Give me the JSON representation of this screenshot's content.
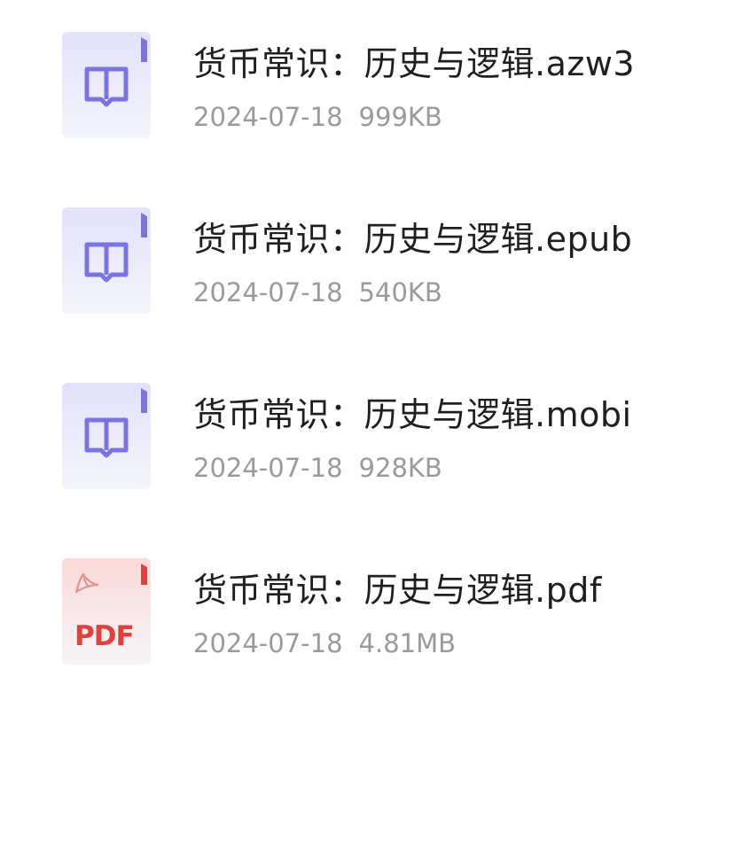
{
  "files": [
    {
      "name": "货币常识：历史与逻辑.azw3",
      "date": "2024-07-18",
      "size": "999KB",
      "icon": "ebook-icon",
      "icon_color": "#7b74e0"
    },
    {
      "name": "货币常识：历史与逻辑.epub",
      "date": "2024-07-18",
      "size": "540KB",
      "icon": "ebook-icon",
      "icon_color": "#7b74e0"
    },
    {
      "name": "货币常识：历史与逻辑.mobi",
      "date": "2024-07-18",
      "size": "928KB",
      "icon": "ebook-icon",
      "icon_color": "#7b74e0"
    },
    {
      "name": "货币常识：历史与逻辑.pdf",
      "date": "2024-07-18",
      "size": "4.81MB",
      "icon": "pdf-icon",
      "icon_color": "#e0413c",
      "icon_label": "PDF"
    }
  ]
}
